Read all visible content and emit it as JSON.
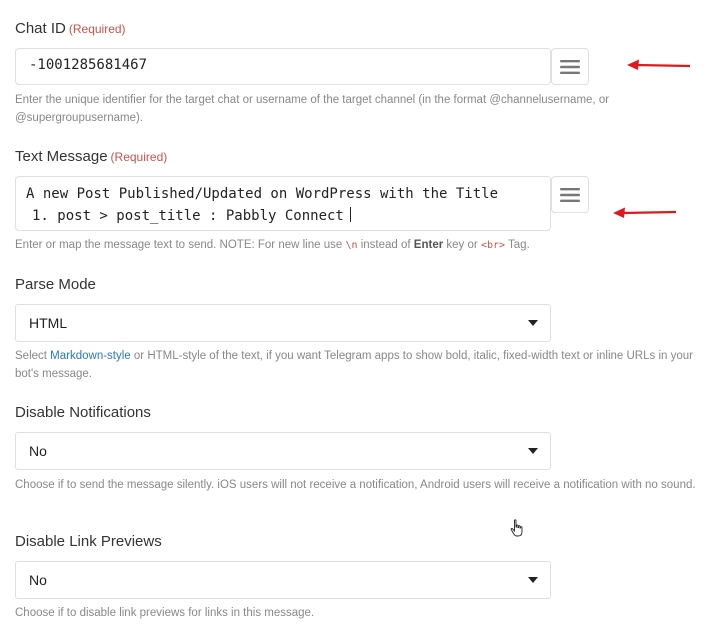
{
  "chat_id": {
    "label": "Chat ID",
    "required": "(Required)",
    "value": "-1001285681467",
    "help": "Enter the unique identifier for the target chat or username of the target channel (in the format @channelusername, or @supergroupusername)."
  },
  "text_message": {
    "label": "Text Message",
    "required": "(Required)",
    "line1": "A new Post Published/Updated on WordPress with the Title",
    "line2": "1. post > post_title : Pabbly Connect",
    "help_1": "Enter or map the message text to send. NOTE: For new line use",
    "help_code_1": "\\n",
    "help_2": "instead of",
    "help_bold": "Enter",
    "help_3": "key or",
    "help_code_2": "<br>",
    "help_4": "Tag."
  },
  "parse_mode": {
    "label": "Parse Mode",
    "value": "HTML",
    "help_1": "Select",
    "help_link": "Markdown-style",
    "help_2": "or HTML-style of the text, if you want Telegram apps to show bold, italic, fixed-width text or inline URLs in your bot's message."
  },
  "disable_notifications": {
    "label": "Disable Notifications",
    "value": "No",
    "help": "Choose if to send the message silently. iOS users will not receive a notification, Android users will receive a notification with no sound."
  },
  "disable_link_previews": {
    "label": "Disable Link Previews",
    "value": "No",
    "help": "Choose if to disable link previews for links in this message."
  },
  "icons": [
    "menu-icon",
    "caret-down-icon",
    "arrow-left-icon",
    "hand-cursor-icon"
  ],
  "colors": {
    "required": "#c9534a",
    "link": "#2a7ab8",
    "arrow": "#e0191f",
    "help": "#888888"
  }
}
